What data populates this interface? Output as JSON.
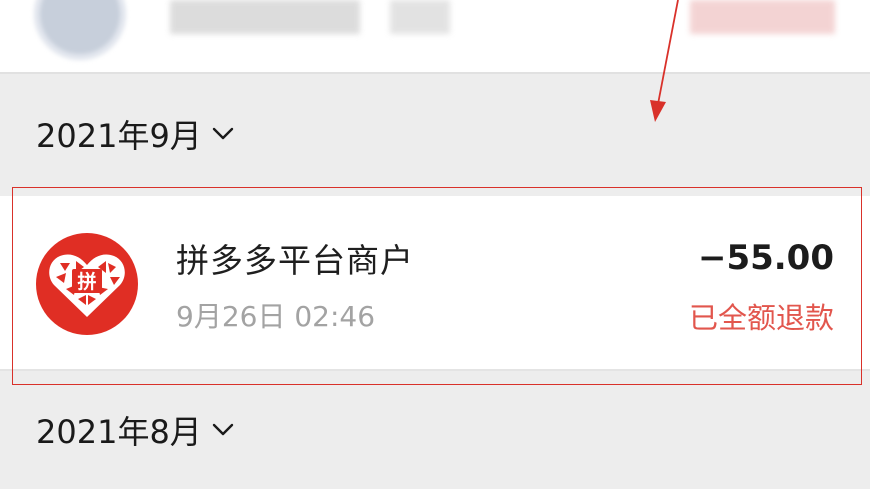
{
  "months": [
    {
      "label": "2021年9月"
    },
    {
      "label": "2021年8月"
    }
  ],
  "transaction": {
    "merchant": "拼多多平台商户",
    "datetime": "9月26日 02:46",
    "amount": "−55.00",
    "status": "已全额退款",
    "logo_text": "拼",
    "logo_color": "#e02e24",
    "status_color": "#e2564d"
  },
  "annotation": {
    "box_color": "#d9312a"
  }
}
